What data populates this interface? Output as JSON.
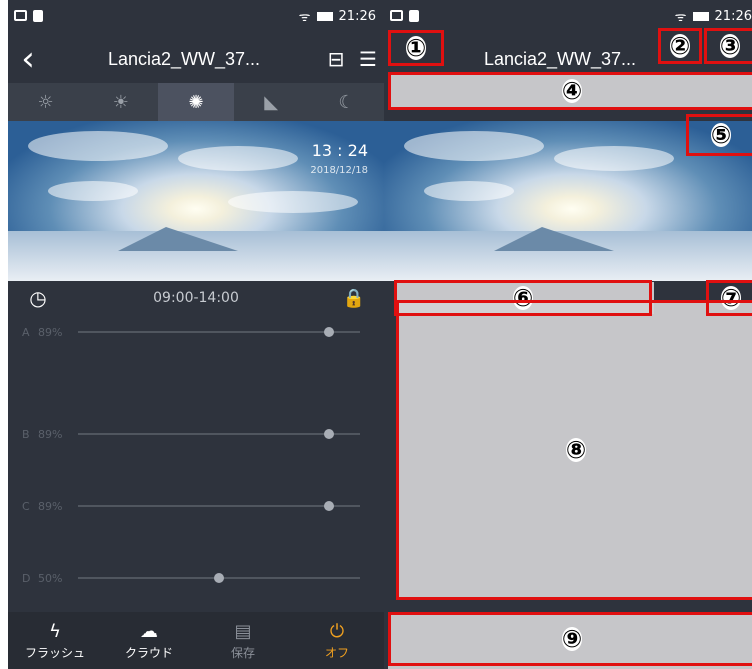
{
  "status": {
    "time": "21:26"
  },
  "header": {
    "title": "Lancia2_WW_37...",
    "back_icon": "chevron-left-icon",
    "qr_icon": "scan-icon",
    "menu_icon": "hamburger-icon"
  },
  "tabs": [
    {
      "name": "sunrise-icon",
      "glyph": "☼"
    },
    {
      "name": "morning-icon",
      "glyph": "☀"
    },
    {
      "name": "noon-icon",
      "glyph": "✺"
    },
    {
      "name": "evening-icon",
      "glyph": "◣"
    },
    {
      "name": "night-icon",
      "glyph": "☾"
    }
  ],
  "photo": {
    "time": "13 : 24",
    "date": "2018/12/18"
  },
  "schedule": {
    "range": "09:00-14:00"
  },
  "channels": [
    {
      "letter": "A",
      "percent": "89%",
      "value": 0.89
    },
    {
      "letter": "B",
      "percent": "89%",
      "value": 0.89
    },
    {
      "letter": "C",
      "percent": "89%",
      "value": 0.89
    },
    {
      "letter": "D",
      "percent": "50%",
      "value": 0.5
    }
  ],
  "bottom": {
    "flash": "フラッシュ",
    "cloud": "クラウド",
    "save": "保存",
    "off": "オフ"
  },
  "annotations": [
    "①",
    "②",
    "③",
    "④",
    "⑤",
    "⑥",
    "⑦",
    "⑧",
    "⑨"
  ],
  "colors": {
    "accent": "#f0a020",
    "highlight": "#e01010"
  }
}
